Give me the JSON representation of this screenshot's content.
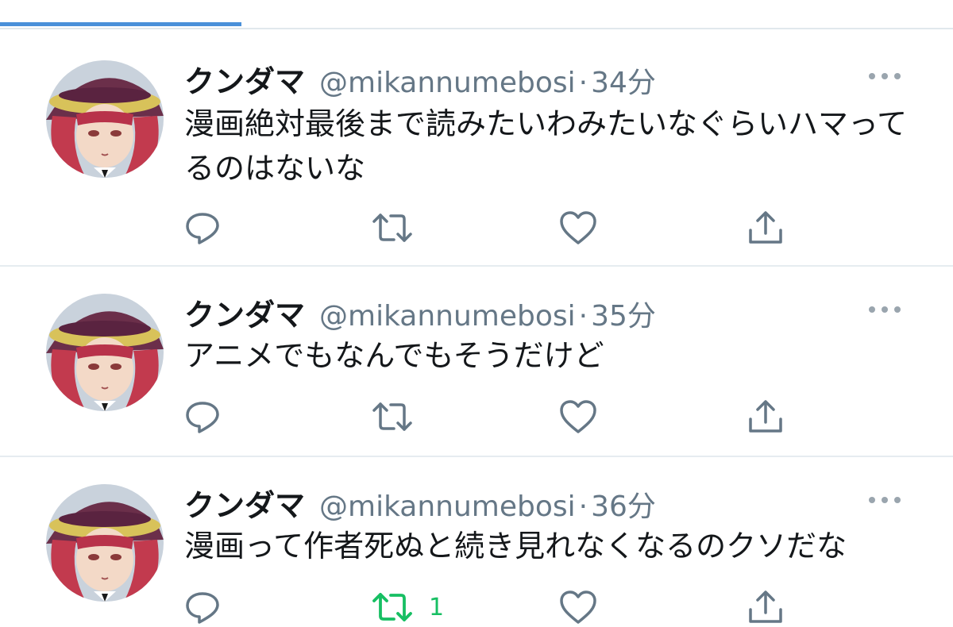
{
  "colors": {
    "accent": "#4a90d9",
    "text": "#14171a",
    "secondary": "#657786",
    "retweeted": "#17bf63"
  },
  "tweets": [
    {
      "name": "クンダマ",
      "handle": "@mikannumebosi",
      "separator": "·",
      "time": "34分",
      "text": "漫画絶対最後まで読みたいわみたいなぐらいハマってるのはないな",
      "retweeted": false,
      "retweet_count": ""
    },
    {
      "name": "クンダマ",
      "handle": "@mikannumebosi",
      "separator": "·",
      "time": "35分",
      "text": "アニメでもなんでもそうだけど",
      "retweeted": false,
      "retweet_count": ""
    },
    {
      "name": "クンダマ",
      "handle": "@mikannumebosi",
      "separator": "·",
      "time": "36分",
      "text": "漫画って作者死ぬと続き見れなくなるのクソだな",
      "retweeted": true,
      "retweet_count": "1"
    }
  ]
}
